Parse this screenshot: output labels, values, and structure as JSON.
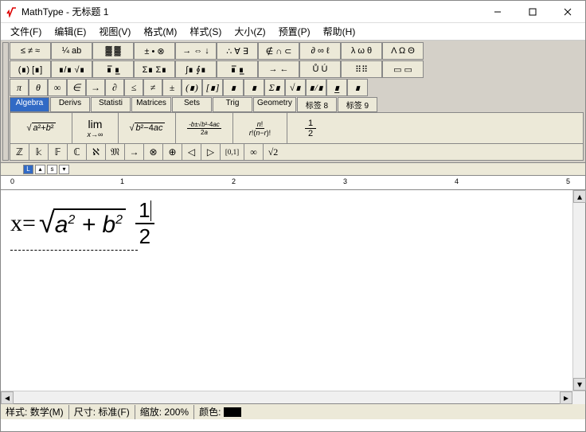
{
  "window": {
    "title": "MathType - 无标题 1"
  },
  "menu": {
    "file": "文件(F)",
    "edit": "编辑(E)",
    "view": "视图(V)",
    "format": "格式(M)",
    "style": "样式(S)",
    "size": "大小(Z)",
    "prefs": "预置(P)",
    "help": "帮助(H)"
  },
  "palette_row1": [
    "≤ ≠ ≈",
    "¼ ab",
    "▓ ▓",
    "± • ⊗",
    "→ ⇔ ↓",
    "∴ ∀ ∃",
    "∉ ∩ ⊂",
    "∂ ∞ ℓ",
    "λ ω θ",
    "Λ Ω Θ"
  ],
  "palette_row2": [
    "(∎) [∎]",
    "∎/∎ √∎",
    "∎̅ ∎̲",
    "Σ∎ Σ∎",
    "∫∎ ∮∎",
    "∎̅ ∎̲",
    "→ ←",
    "Ů Ú",
    "⠿⠿",
    "▭ ▭"
  ],
  "palette_row3": [
    "π",
    "θ",
    "∞",
    "∈",
    "→",
    "∂",
    "≤",
    "≠",
    "±",
    "(∎)",
    "[∎]",
    "∎",
    "∎",
    "Σ∎",
    "√∎",
    "∎/∎",
    "∎̲",
    "∎"
  ],
  "tabs": [
    "Algebra",
    "Derivs",
    "Statisti",
    "Matrices",
    "Sets",
    "Trig",
    "Geometry",
    "标签 8",
    "标签 9"
  ],
  "templates": {
    "sqrt_ab": "√(a²+b²)",
    "lim": "lim x→∞",
    "disc": "√(b²−4ac)",
    "quad": "(-b±√(b²-4ac))/2a",
    "perm": "n!/(r!(n−r)!)",
    "half": "1/2"
  },
  "symbols": [
    "ℤ",
    "𝕜",
    "𝔽",
    "ℂ",
    "ℵ",
    "𝔐",
    "→",
    "⊗",
    "⊕",
    "◁",
    "▷",
    "[0,1]",
    "∞",
    "√2"
  ],
  "ruler": {
    "marks": [
      "0",
      "1",
      "2",
      "3",
      "4",
      "5"
    ]
  },
  "formula": {
    "lhs": "x=",
    "sqrt_inner": "a² + b²",
    "frac_num": "1",
    "frac_den": "2"
  },
  "status": {
    "style_label": "样式:",
    "style_value": "数学(M)",
    "size_label": "尺寸:",
    "size_value": "标准(F)",
    "zoom_label": "缩放:",
    "zoom_value": "200%",
    "color_label": "颜色:"
  }
}
